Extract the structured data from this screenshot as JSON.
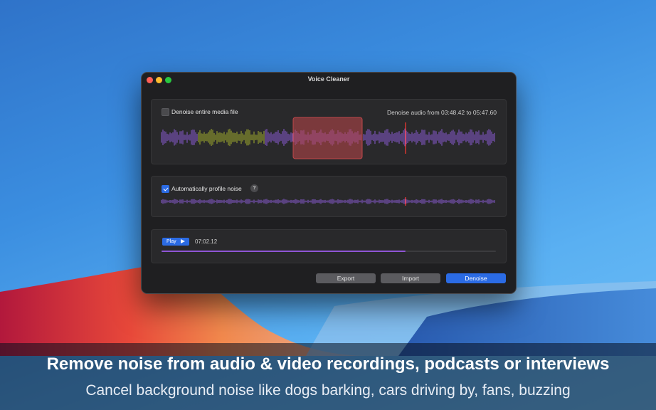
{
  "window": {
    "title": "Voice Cleaner"
  },
  "denoise_panel": {
    "checkbox_label": "Denoise entire media file",
    "checked": false,
    "range_text": "Denoise audio from 03:48.42 to 05:47.60"
  },
  "profile_panel": {
    "checkbox_label": "Automatically profile noise",
    "checked": true,
    "help_label": "?"
  },
  "playback": {
    "play_label": "Play",
    "time": "07:02.12",
    "progress": 0.73
  },
  "buttons": {
    "export": "Export",
    "import": "Import",
    "denoise": "Denoise"
  },
  "caption": {
    "headline": "Remove noise from audio & video recordings, podcasts or interviews",
    "subline": "Cancel background noise like dogs barking, cars driving by, fans, buzzing"
  },
  "colors": {
    "accent": "#2b6be4",
    "waveform": "#8a5cd4",
    "noise_profile": "#a3b02d",
    "selection": "#c0474a",
    "playhead": "#ff3b30"
  }
}
